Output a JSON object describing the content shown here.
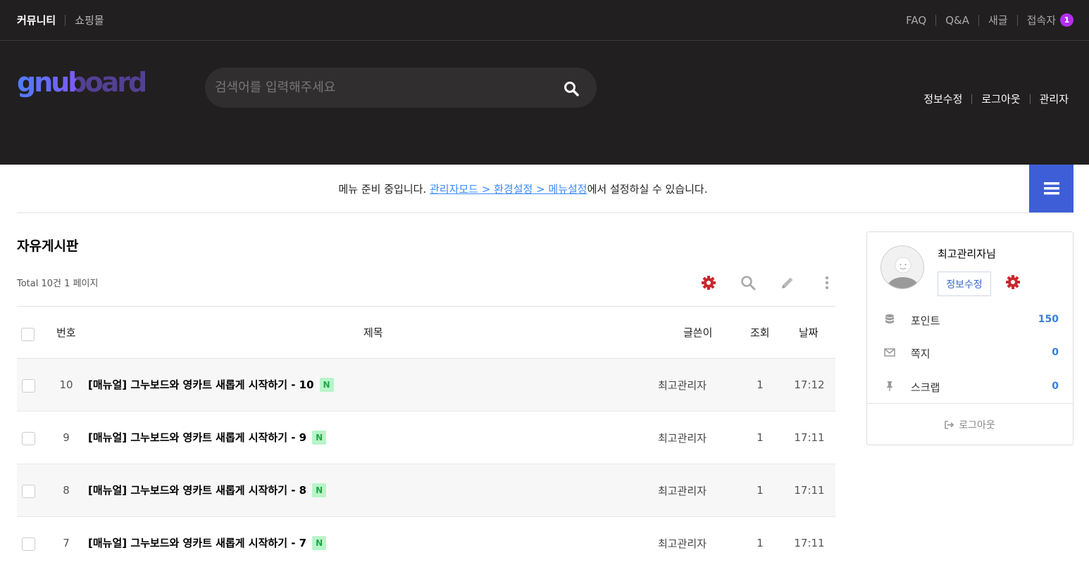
{
  "topbar": {
    "left_links": [
      "커뮤니티",
      "쇼핑몰"
    ],
    "right_links": [
      "FAQ",
      "Q&A",
      "새글",
      "접속자"
    ],
    "visitor_count": "1"
  },
  "header": {
    "logo_text": "gnuboard",
    "search_placeholder": "검색어를 입력해주세요",
    "links": [
      "정보수정",
      "로그아웃",
      "관리자"
    ]
  },
  "notice": {
    "prefix": "메뉴 준비 중입니다. ",
    "link": "관리자모드 > 환경설정 > 메뉴설정",
    "suffix": "에서 설정하실 수 있습니다."
  },
  "board": {
    "title": "자유게시판",
    "total": "Total 10건 1 페이지",
    "columns": [
      "번호",
      "제목",
      "글쓴이",
      "조회",
      "날짜"
    ],
    "rows": [
      {
        "num": "10",
        "subject": "[매뉴얼] 그누보드와 영카트 새롭게 시작하기 - 10",
        "badge": "N",
        "writer": "최고관리자",
        "hits": "1",
        "date": "17:12"
      },
      {
        "num": "9",
        "subject": "[매뉴얼] 그누보드와 영카트 새롭게 시작하기 - 9",
        "badge": "N",
        "writer": "최고관리자",
        "hits": "1",
        "date": "17:11"
      },
      {
        "num": "8",
        "subject": "[매뉴얼] 그누보드와 영카트 새롭게 시작하기 - 8",
        "badge": "N",
        "writer": "최고관리자",
        "hits": "1",
        "date": "17:11"
      },
      {
        "num": "7",
        "subject": "[매뉴얼] 그누보드와 영카트 새롭게 시작하기 - 7",
        "badge": "N",
        "writer": "최고관리자",
        "hits": "1",
        "date": "17:11"
      }
    ]
  },
  "side": {
    "name": "최고관리자님",
    "edit_label": "정보수정",
    "items": [
      {
        "label": "포인트",
        "value": "150"
      },
      {
        "label": "쪽지",
        "value": "0"
      },
      {
        "label": "스크랩",
        "value": "0"
      }
    ],
    "logout_label": "로그아웃"
  },
  "colors": {
    "dark_bg": "#211f20",
    "accent_blue": "#3e5ed8",
    "badge_purple": "#b22ff0",
    "gear_red": "#c8282e",
    "new_green": "#b7f5c8"
  }
}
